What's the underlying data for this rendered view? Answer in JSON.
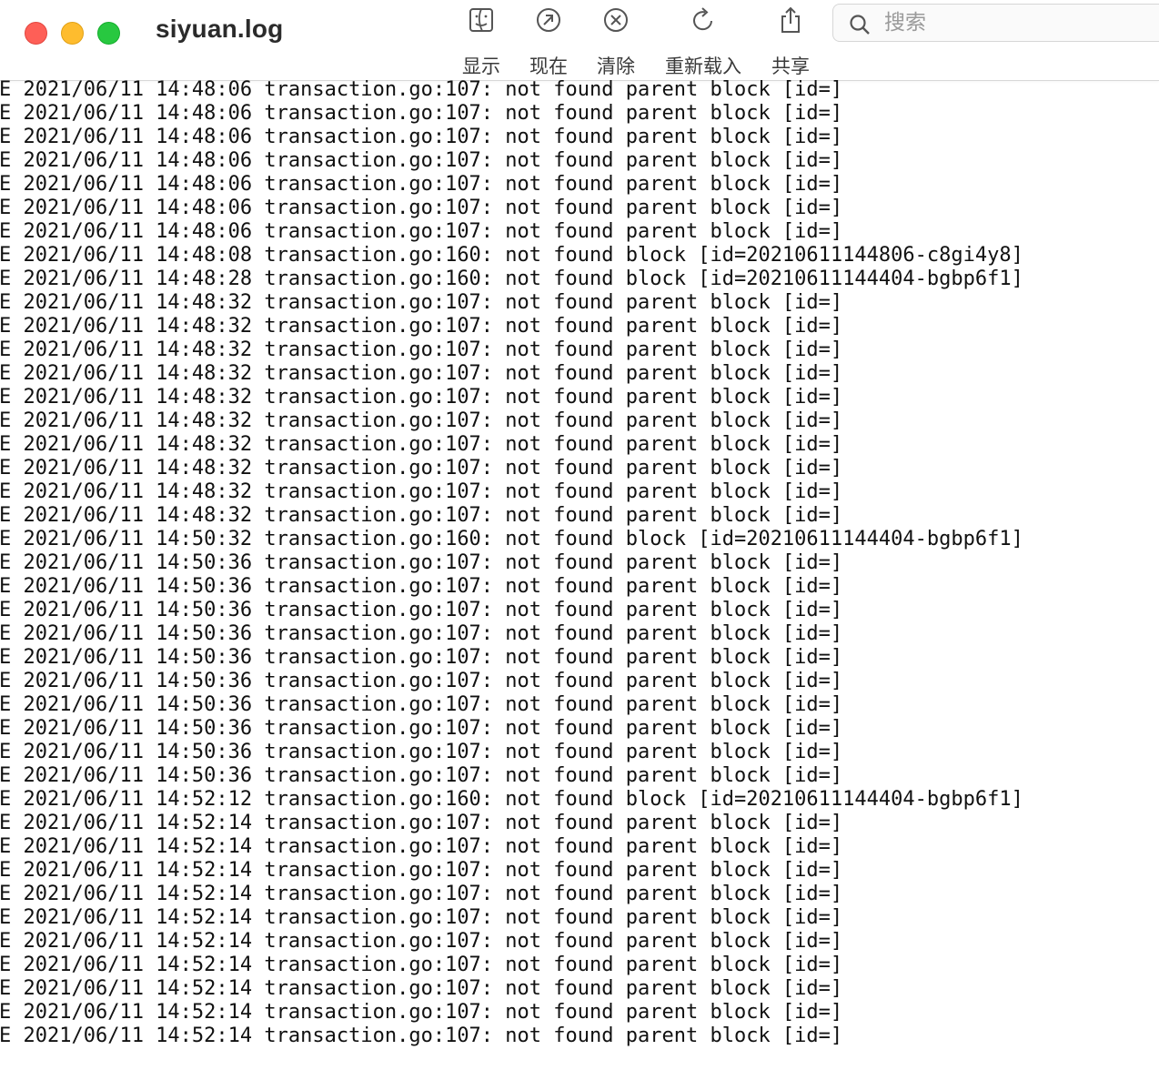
{
  "window": {
    "title": "siyuan.log"
  },
  "toolbar": {
    "items": [
      {
        "label": "显示",
        "icon": "show-in-finder-icon"
      },
      {
        "label": "现在",
        "icon": "now-clock-icon"
      },
      {
        "label": "清除",
        "icon": "clear-icon"
      },
      {
        "label": "重新载入",
        "icon": "reload-icon"
      },
      {
        "label": "共享",
        "icon": "share-icon"
      }
    ]
  },
  "search": {
    "placeholder": "搜索",
    "value": ""
  },
  "log": {
    "lines": [
      "E 2021/06/11 14:48:06 transaction.go:107: not found parent block [id=]",
      "E 2021/06/11 14:48:06 transaction.go:107: not found parent block [id=]",
      "E 2021/06/11 14:48:06 transaction.go:107: not found parent block [id=]",
      "E 2021/06/11 14:48:06 transaction.go:107: not found parent block [id=]",
      "E 2021/06/11 14:48:06 transaction.go:107: not found parent block [id=]",
      "E 2021/06/11 14:48:06 transaction.go:107: not found parent block [id=]",
      "E 2021/06/11 14:48:06 transaction.go:107: not found parent block [id=]",
      "E 2021/06/11 14:48:08 transaction.go:160: not found block [id=20210611144806-c8gi4y8]",
      "E 2021/06/11 14:48:28 transaction.go:160: not found block [id=20210611144404-bgbp6f1]",
      "E 2021/06/11 14:48:32 transaction.go:107: not found parent block [id=]",
      "E 2021/06/11 14:48:32 transaction.go:107: not found parent block [id=]",
      "E 2021/06/11 14:48:32 transaction.go:107: not found parent block [id=]",
      "E 2021/06/11 14:48:32 transaction.go:107: not found parent block [id=]",
      "E 2021/06/11 14:48:32 transaction.go:107: not found parent block [id=]",
      "E 2021/06/11 14:48:32 transaction.go:107: not found parent block [id=]",
      "E 2021/06/11 14:48:32 transaction.go:107: not found parent block [id=]",
      "E 2021/06/11 14:48:32 transaction.go:107: not found parent block [id=]",
      "E 2021/06/11 14:48:32 transaction.go:107: not found parent block [id=]",
      "E 2021/06/11 14:48:32 transaction.go:107: not found parent block [id=]",
      "E 2021/06/11 14:50:32 transaction.go:160: not found block [id=20210611144404-bgbp6f1]",
      "E 2021/06/11 14:50:36 transaction.go:107: not found parent block [id=]",
      "E 2021/06/11 14:50:36 transaction.go:107: not found parent block [id=]",
      "E 2021/06/11 14:50:36 transaction.go:107: not found parent block [id=]",
      "E 2021/06/11 14:50:36 transaction.go:107: not found parent block [id=]",
      "E 2021/06/11 14:50:36 transaction.go:107: not found parent block [id=]",
      "E 2021/06/11 14:50:36 transaction.go:107: not found parent block [id=]",
      "E 2021/06/11 14:50:36 transaction.go:107: not found parent block [id=]",
      "E 2021/06/11 14:50:36 transaction.go:107: not found parent block [id=]",
      "E 2021/06/11 14:50:36 transaction.go:107: not found parent block [id=]",
      "E 2021/06/11 14:50:36 transaction.go:107: not found parent block [id=]",
      "E 2021/06/11 14:52:12 transaction.go:160: not found block [id=20210611144404-bgbp6f1]",
      "E 2021/06/11 14:52:14 transaction.go:107: not found parent block [id=]",
      "E 2021/06/11 14:52:14 transaction.go:107: not found parent block [id=]",
      "E 2021/06/11 14:52:14 transaction.go:107: not found parent block [id=]",
      "E 2021/06/11 14:52:14 transaction.go:107: not found parent block [id=]",
      "E 2021/06/11 14:52:14 transaction.go:107: not found parent block [id=]",
      "E 2021/06/11 14:52:14 transaction.go:107: not found parent block [id=]",
      "E 2021/06/11 14:52:14 transaction.go:107: not found parent block [id=]",
      "E 2021/06/11 14:52:14 transaction.go:107: not found parent block [id=]",
      "E 2021/06/11 14:52:14 transaction.go:107: not found parent block [id=]",
      "E 2021/06/11 14:52:14 transaction.go:107: not found parent block [id=]"
    ]
  },
  "colors": {
    "close": "#fe5f57",
    "minimize": "#febc2e",
    "maximize": "#28c840",
    "text": "#111111"
  }
}
